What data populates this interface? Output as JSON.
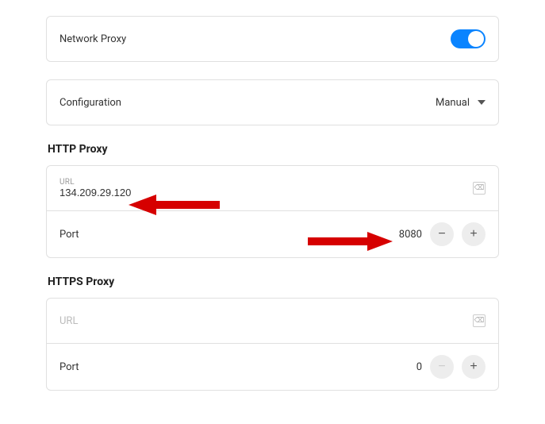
{
  "networkProxy": {
    "label": "Network Proxy",
    "enabled": true
  },
  "configuration": {
    "label": "Configuration",
    "value": "Manual"
  },
  "httpProxy": {
    "title": "HTTP Proxy",
    "urlLabel": "URL",
    "urlValue": "134.209.29.120",
    "portLabel": "Port",
    "portValue": "8080"
  },
  "httpsProxy": {
    "title": "HTTPS Proxy",
    "urlLabel": "URL",
    "urlValue": "",
    "portLabel": "Port",
    "portValue": "0"
  }
}
